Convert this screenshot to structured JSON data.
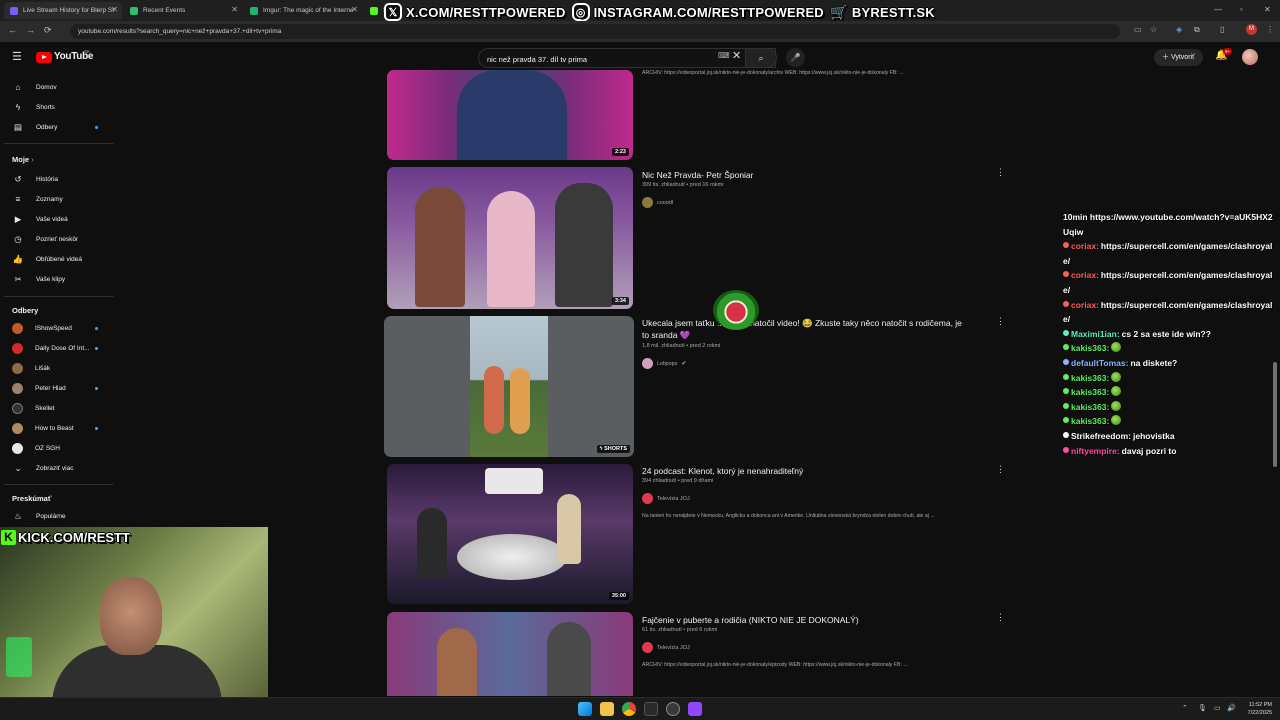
{
  "browser": {
    "tabs": [
      {
        "title": "Live Stream History for Blerp St",
        "color": "#7c5cff"
      },
      {
        "title": "Recent Events",
        "color": "#2fbf71"
      },
      {
        "title": "Imgur: The magic of the Interne",
        "color": "#1bb76e"
      },
      {
        "title": "St",
        "color": "#53fc18"
      }
    ],
    "url": "youtube.com/results?search_query=nic+než+pravda+37.+dil+tv+prima"
  },
  "overlay": {
    "x": "X.COM/RESTTPOWERED",
    "instagram": "INSTAGRAM.COM/RESTTPOWERED",
    "shop": "BYRESTT.SK",
    "kick": "KICK.COM/RESTT"
  },
  "header": {
    "logo": "YouTube",
    "region": "SK",
    "search_value": "nic než pravda 37. díl tv prima",
    "create_label": "Vytvoriť",
    "notif_count": "9+"
  },
  "sidebar": {
    "main": [
      {
        "label": "Domov",
        "icon": "home-icon"
      },
      {
        "label": "Shorts",
        "icon": "shorts-icon"
      },
      {
        "label": "Odbery",
        "icon": "subscriptions-icon"
      }
    ],
    "you_header": "Moje",
    "you": [
      {
        "label": "História"
      },
      {
        "label": "Zoznamy"
      },
      {
        "label": "Vaše videá"
      },
      {
        "label": "Pozrieť neskôr"
      },
      {
        "label": "Obľúbené videá"
      },
      {
        "label": "Vaše klipy"
      }
    ],
    "subs_header": "Odbery",
    "subs": [
      {
        "label": "IShowSpeed",
        "color": "#c25a2a",
        "live": true
      },
      {
        "label": "Daily Dose Of Int...",
        "color": "#d42a2a",
        "live": true
      },
      {
        "label": "Lišák",
        "color": "#8a6a4a",
        "live": false
      },
      {
        "label": "Peter Hlad",
        "color": "#a08070",
        "live": true
      },
      {
        "label": "Skellet",
        "color": "#333333",
        "live": false
      },
      {
        "label": "How to Beast",
        "color": "#b08a60",
        "live": true
      },
      {
        "label": "OZ SGH",
        "color": "#e8e8e8",
        "live": false
      }
    ],
    "show_more": "Zobraziť viac",
    "explore_header": "Preskúmať",
    "explore": [
      {
        "label": "Populárne"
      }
    ]
  },
  "results": [
    {
      "title": "",
      "views": "",
      "channel": "",
      "desc": "ARCHÍV: https://videoportal.joj.sk/nikto-nie-je-dokonaly/archiv WEB: https://www.joj.sk/nikto-nie-je-dokonaly FB: ...",
      "duration": "2:23"
    },
    {
      "title": "Nic Než Pravda- Petr Šponiar",
      "views": "309 tis. zhliadnutí • pred 16 rokmi",
      "channel": "cooodl",
      "desc": "",
      "duration": "3:34"
    },
    {
      "title": "Ukecala jsem taťku ... mnou natočil video! 😂 Zkuste taky něco natočit s rodičema, je to sranda 💜",
      "views": "1,8 mil. zhliadnutí • pred 2 rokmi",
      "channel": "Lolipopz",
      "desc": "",
      "duration": "SHORTS"
    },
    {
      "title": "24 podcast: Klenot, ktorý je nenahraditeľný",
      "views": "394 zhliadnutí • pred 9 dňami",
      "channel": "Televízia JOJ",
      "desc": "Na tanieri ho nenájdete v Nemecku, Anglicku a dokonca ani v Amerike. Unikátna slovenská bryndza nielen dobre chutí, ale aj ...",
      "duration": "35:00"
    },
    {
      "title": "Fajčenie v puberte a rodičia (NIKTO NIE JE DOKONALÝ)",
      "views": "61 tis. zhliadnutí • pred 6 rokmi",
      "channel": "Televízia JOJ",
      "desc": "ARCHÍV: https://videoportal.joj.sk/nikto-nie-je-dokonaly/epizody WEB: https://www.joj.sk/nikto-nie-je-dokonaly FB: ...",
      "duration": ""
    }
  ],
  "chat": [
    {
      "user": "",
      "text": "10min https://www.youtube.com/watch?v=aUK5HX2Uqiw",
      "color": "#ffffff"
    },
    {
      "user": "coriax:",
      "text": "https://supercell.com/en/games/clashroyale/",
      "color": "#ff5c5c"
    },
    {
      "user": "coriax:",
      "text": "https://supercell.com/en/games/clashroyale/",
      "color": "#ff5c5c"
    },
    {
      "user": "coriax:",
      "text": "https://supercell.com/en/games/clashroyale/",
      "color": "#ff5c5c"
    },
    {
      "user": "Maximi1ian:",
      "text": "cs 2 sa este ide win??",
      "color": "#5cf0c8"
    },
    {
      "user": "kakis363:",
      "text": "",
      "color": "#5cf05c",
      "emote": true
    },
    {
      "user": "defaultTomas:",
      "text": "na diskete?",
      "color": "#8ab4ff"
    },
    {
      "user": "kakis363:",
      "text": "",
      "color": "#5cf05c",
      "emote": true
    },
    {
      "user": "kakis363:",
      "text": "",
      "color": "#5cf05c",
      "emote": true
    },
    {
      "user": "kakis363:",
      "text": "",
      "color": "#5cf05c",
      "emote": true
    },
    {
      "user": "kakis363:",
      "text": "",
      "color": "#5cf05c",
      "emote": true
    },
    {
      "user": "Strikefreedom:",
      "text": "jehovistka",
      "color": "#ffffff"
    },
    {
      "user": "niftyempire:",
      "text": "davaj pozri to",
      "color": "#ff4da6"
    }
  ],
  "taskbar": {
    "time": "11:52 PM",
    "date": "7/22/2025"
  }
}
